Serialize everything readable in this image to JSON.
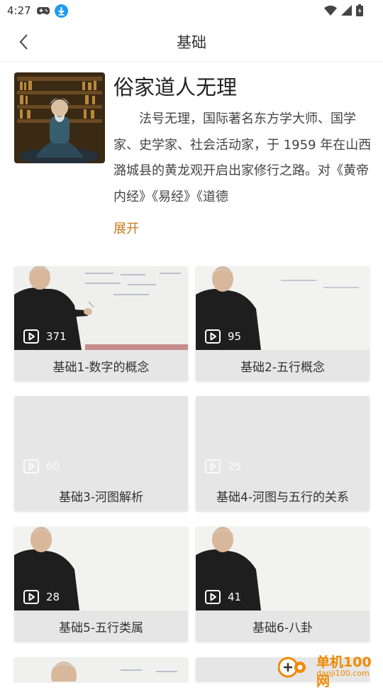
{
  "status": {
    "time": "4:27"
  },
  "header": {
    "title": "基础"
  },
  "author": {
    "name": "俗家道人无理",
    "bio": "法号无理，国际著名东方学大师、国学家、史学家、社会活动家，于 1959 年在山西潞城县的黄龙观开启出家修行之路。对《黄帝内经》《易经》《道德",
    "expand_label": "展开"
  },
  "courses": [
    {
      "title": "基础1-数字的概念",
      "plays": "371"
    },
    {
      "title": "基础2-五行概念",
      "plays": "95"
    },
    {
      "title": "基础3-河图解析",
      "plays": "60"
    },
    {
      "title": "基础4-河图与五行的关系",
      "plays": "25"
    },
    {
      "title": "基础5-五行类属",
      "plays": "28"
    },
    {
      "title": "基础6-八卦",
      "plays": "41"
    }
  ],
  "watermark": {
    "name": "单机100网",
    "url": "danji100.com"
  },
  "colors": {
    "accent": "#c8781e",
    "card_bg": "#e6e6e6",
    "watermark": "#f08a00"
  }
}
